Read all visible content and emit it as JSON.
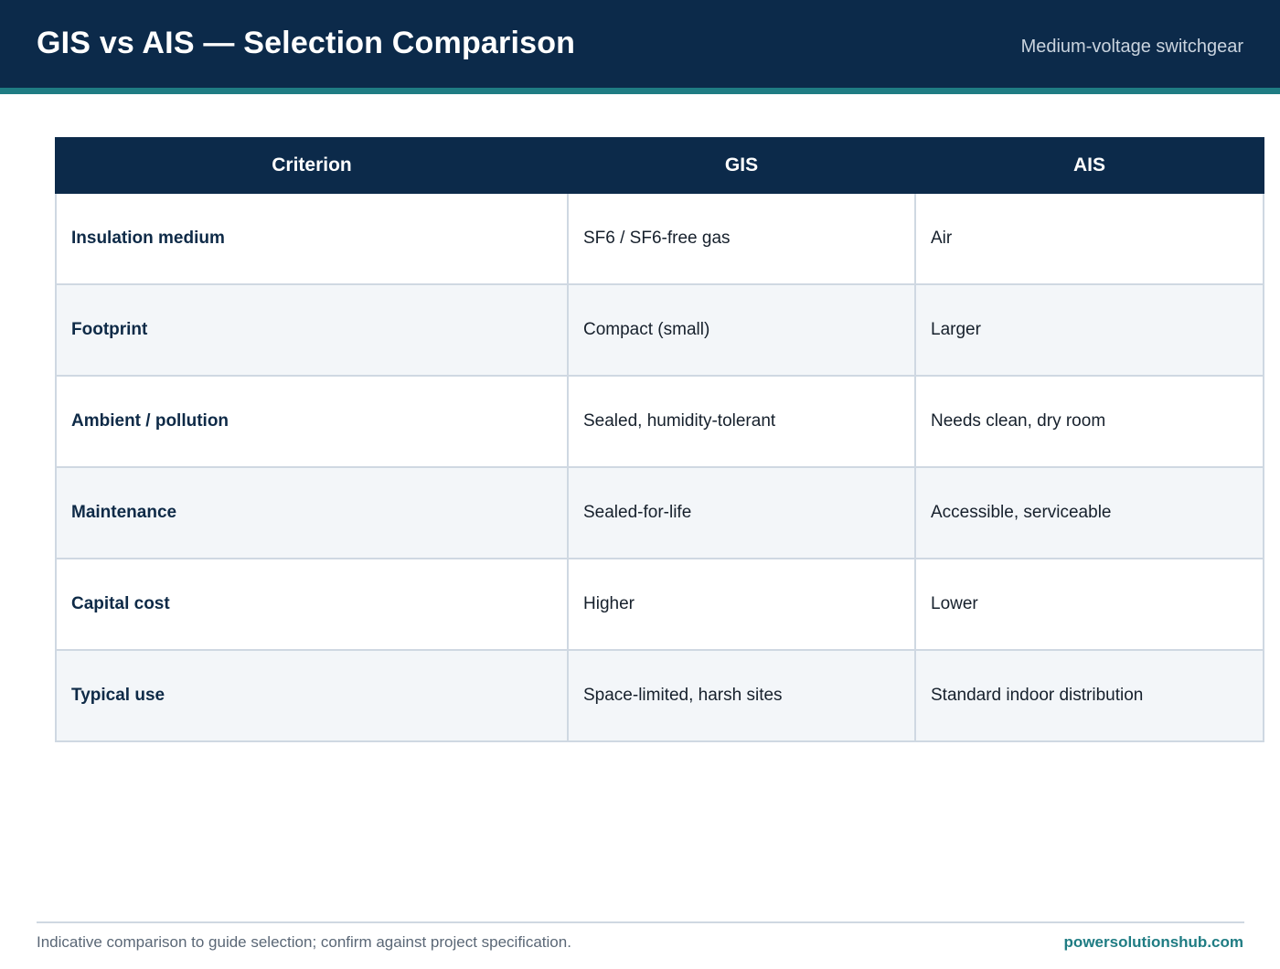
{
  "header": {
    "title": "GIS vs AIS — Selection Comparison",
    "subtitle": "Medium-voltage switchgear"
  },
  "colors": {
    "header_bg": "#0c2a4a",
    "accent": "#1f7c83",
    "row_alt_bg": "#f3f6f9",
    "border": "#cfd8e2"
  },
  "table": {
    "columns": [
      "Criterion",
      "GIS",
      "AIS"
    ],
    "rows": [
      {
        "criterion": "Insulation medium",
        "gis": "SF6 / SF6-free gas",
        "ais": "Air"
      },
      {
        "criterion": "Footprint",
        "gis": "Compact (small)",
        "ais": "Larger"
      },
      {
        "criterion": "Ambient / pollution",
        "gis": "Sealed, humidity-tolerant",
        "ais": "Needs clean, dry room"
      },
      {
        "criterion": "Maintenance",
        "gis": "Sealed-for-life",
        "ais": "Accessible, serviceable"
      },
      {
        "criterion": "Capital cost",
        "gis": "Higher",
        "ais": "Lower"
      },
      {
        "criterion": "Typical use",
        "gis": "Space-limited, harsh sites",
        "ais": "Standard indoor distribution"
      }
    ]
  },
  "footer": {
    "note": "Indicative comparison to guide selection; confirm against project specification.",
    "brand": "powersolutionshub.com"
  }
}
